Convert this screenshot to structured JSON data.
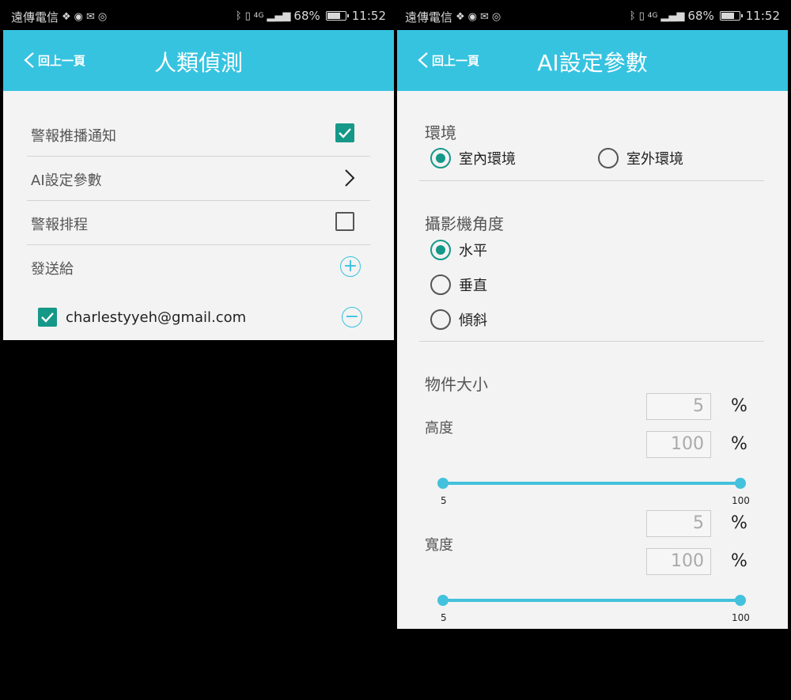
{
  "status_bar": {
    "carrier": "遠傳電信",
    "battery": "68%",
    "battery_fraction": 0.68,
    "time": "11:52",
    "network": "4G"
  },
  "left": {
    "back_label": "回上一頁",
    "title": "人類偵測",
    "rows": [
      {
        "label": "警報推播通知",
        "control": "checkbox",
        "checked": true
      },
      {
        "label": "AI設定參數",
        "control": "chevron"
      },
      {
        "label": "警報排程",
        "control": "checkbox",
        "checked": false
      },
      {
        "label": "發送給",
        "control": "add"
      }
    ],
    "recipients": [
      {
        "email": "charlestyyeh@gmail.com",
        "checked": true
      }
    ]
  },
  "right": {
    "back_label": "回上一頁",
    "title": "AI設定參數",
    "environment": {
      "title": "環境",
      "options": [
        "室內環境",
        "室外環境"
      ],
      "selected": "室內環境"
    },
    "camera_angle": {
      "title": "攝影機角度",
      "options": [
        "水平",
        "垂直",
        "傾斜"
      ],
      "selected": "水平"
    },
    "object_size": {
      "title": "物件大小",
      "height": {
        "label": "高度",
        "min_value": "5",
        "max_value": "100",
        "unit": "%",
        "range_min": "5",
        "range_max": "100"
      },
      "width": {
        "label": "寬度",
        "min_value": "5",
        "max_value": "100",
        "unit": "%",
        "range_min": "5",
        "range_max": "100"
      }
    }
  },
  "colors": {
    "appbar": "#36c3e0",
    "accent": "#159888",
    "slider": "#44c1dc"
  }
}
